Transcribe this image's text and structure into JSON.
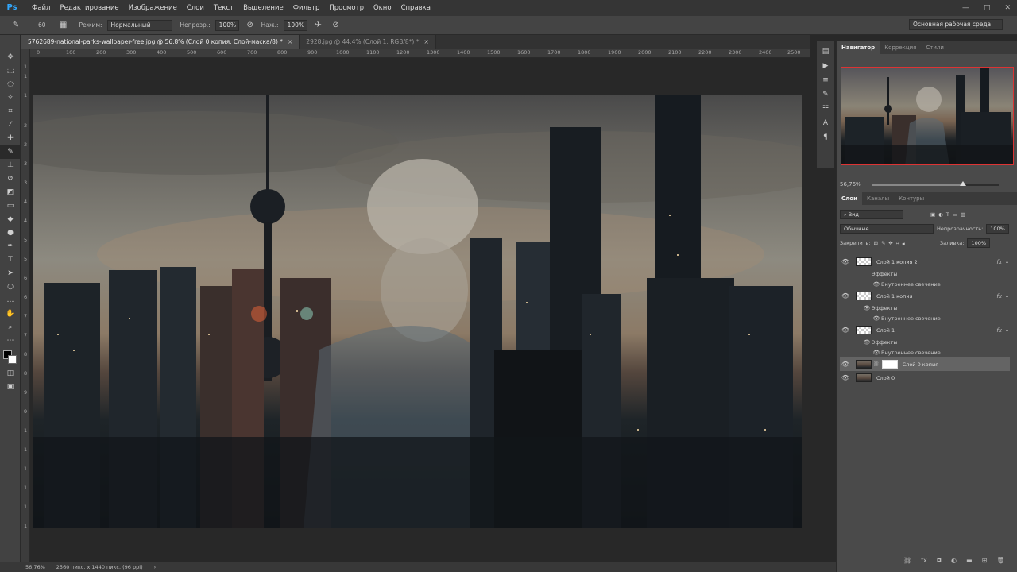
{
  "app": {
    "logo": "Ps"
  },
  "menu": [
    "Файл",
    "Редактирование",
    "Изображение",
    "Слои",
    "Текст",
    "Выделение",
    "Фильтр",
    "Просмотр",
    "Окно",
    "Справка"
  ],
  "window_controls": {
    "minimize": "—",
    "maximize": "□",
    "close": "✕"
  },
  "options": {
    "brush_size": "60",
    "mode_label": "Режим:",
    "mode_value": "Нормальный",
    "opacity_label": "Непрозр.:",
    "opacity_value": "100%",
    "flow_label": "Наж.:",
    "flow_value": "100%",
    "workspace": "Основная рабочая среда"
  },
  "documents": [
    {
      "title": "5762689-national-parks-wallpaper-free.jpg @ 56,8% (Слой 0 копия, Слой-маска/8) *",
      "close": "×",
      "active": true
    },
    {
      "title": "2928.jpg @ 44,4% (Слой 1, RGB/8*) *",
      "close": "×",
      "active": false
    }
  ],
  "ruler_top": [
    "0",
    "100",
    "200",
    "300",
    "400",
    "500",
    "600",
    "700",
    "800",
    "900",
    "1000",
    "1100",
    "1200",
    "1300",
    "1400",
    "1500",
    "1600",
    "1700",
    "1800",
    "1900",
    "2000",
    "2100",
    "2200",
    "2300",
    "2400",
    "2500"
  ],
  "ruler_left": [
    "1",
    "1",
    "1",
    "2",
    "2",
    "3",
    "3",
    "4",
    "4",
    "5",
    "5",
    "6",
    "6",
    "7",
    "7",
    "8",
    "8",
    "9",
    "9",
    "1",
    "1",
    "1",
    "1",
    "1",
    "1"
  ],
  "status": {
    "zoom": "56,76%",
    "doc_info": "2560 пикс. x 1440 пикс. (96 ppi)",
    "arrow": "›"
  },
  "navigator": {
    "tabs": [
      "Навигатор",
      "Коррекция",
      "Стили"
    ],
    "zoom": "56,76%",
    "zoom_level": 0.72
  },
  "layers": {
    "tabs": [
      "Слои",
      "Каналы",
      "Контуры"
    ],
    "filter_kind": "Вид",
    "blend_mode": "Обычные",
    "opacity_label": "Непрозрачность:",
    "opacity_value": "100%",
    "lock_label": "Закрепить:",
    "fill_label": "Заливка:",
    "fill_value": "100%",
    "fx_label": "fx",
    "items": [
      {
        "name": "Слой 1 копия 2",
        "effects_label": "Эффекты",
        "effect": "Внутреннее свечение"
      },
      {
        "name": "Слой 1 копия",
        "effects_label": "Эффекты",
        "effect": "Внутреннее свечение"
      },
      {
        "name": "Слой 1",
        "effects_label": "Эффекты",
        "effect": "Внутреннее свечение"
      },
      {
        "name": "Слой 0 копия"
      },
      {
        "name": "Слой 0"
      }
    ]
  },
  "colors": {
    "foreground": "#000000",
    "background": "#ffffff",
    "selection_outline": "#dd3333"
  }
}
